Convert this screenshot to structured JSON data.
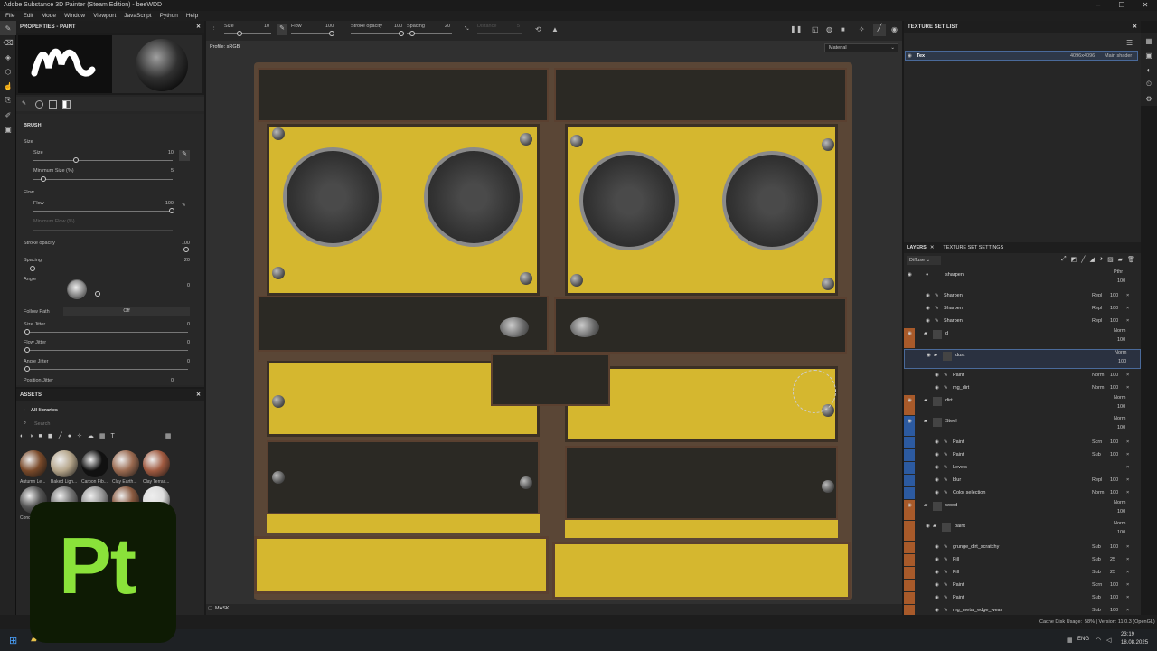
{
  "window": {
    "title": "Adobe Substance 3D Painter (Steam Edition) - beeWDD"
  },
  "menu": [
    "File",
    "Edit",
    "Mode",
    "Window",
    "Viewport",
    "JavaScript",
    "Python",
    "Help"
  ],
  "toolbar": {
    "size_label": "Size",
    "size_value": "10",
    "flow_label": "Flow",
    "flow_value": "100",
    "stroke_label": "Stroke opacity",
    "stroke_value": "100",
    "spacing_label": "Spacing",
    "spacing_value": "20",
    "distance_label": "Distance",
    "distance_value": "5"
  },
  "viewport": {
    "profile": "Profile: sRGB",
    "mode_select": "Material",
    "mask_label": "MASK"
  },
  "properties": {
    "title": "PROPERTIES - PAINT",
    "brush_header": "BRUSH",
    "size_section": "Size",
    "size_label": "Size",
    "size_value": "10",
    "minsize_label": "Minimum Size (%)",
    "minsize_value": "5",
    "flow_section": "Flow",
    "flow_label": "Flow",
    "flow_value": "100",
    "minflow_label": "Minimum Flow (%)",
    "stroke_label": "Stroke opacity",
    "stroke_value": "100",
    "spacing_label": "Spacing",
    "spacing_value": "20",
    "angle_label": "Angle",
    "angle_value": "0",
    "follow_label": "Follow Path",
    "follow_value": "Off",
    "sizej_label": "Size Jitter",
    "sizej_value": "0",
    "flowj_label": "Flow Jitter",
    "flowj_value": "0",
    "anglej_label": "Angle Jitter",
    "anglej_value": "0",
    "posj_label": "Position Jitter",
    "posj_value": "0"
  },
  "assets": {
    "title": "ASSETS",
    "library": "All libraries",
    "search_placeholder": "Search",
    "items": [
      {
        "name": "Autumn Le...",
        "color": "#7a4a2a"
      },
      {
        "name": "Baked Ligh...",
        "color": "#b5a58a"
      },
      {
        "name": "Carbon Fib...",
        "color": "#111111"
      },
      {
        "name": "Clay Earth...",
        "color": "#9a6a50"
      },
      {
        "name": "Clay Terrac...",
        "color": "#a05a40"
      },
      {
        "name": "Conc...",
        "color": "#555555"
      },
      {
        "name": "",
        "color": "#777777"
      },
      {
        "name": "",
        "color": "#999999"
      },
      {
        "name": "",
        "color": "#8a5a40"
      },
      {
        "name": "",
        "color": "#dddddd"
      }
    ]
  },
  "texture_set": {
    "title": "TEXTURE SET LIST",
    "row_name": "Tex",
    "row_size": "4096x4096",
    "row_shader": "Main shader"
  },
  "layers": {
    "tab1": "LAYERS",
    "tab2": "TEXTURE SET SETTINGS",
    "channel": "Diffuse",
    "rows": [
      {
        "name": "sharpen",
        "blend": "Pthr",
        "op": "100",
        "indent": 0,
        "type": "layer"
      },
      {
        "name": "Sharpen",
        "blend": "Repl",
        "op": "100",
        "indent": 1,
        "type": "fx"
      },
      {
        "name": "Sharpen",
        "blend": "Repl",
        "op": "100",
        "indent": 1,
        "type": "fx"
      },
      {
        "name": "Sharpen",
        "blend": "Repl",
        "op": "100",
        "indent": 1,
        "type": "fx"
      },
      {
        "name": "d",
        "blend": "Norm",
        "op": "100",
        "indent": 0,
        "type": "folder"
      },
      {
        "name": "dust",
        "blend": "Norm",
        "op": "100",
        "indent": 1,
        "type": "folder"
      },
      {
        "name": "Paint",
        "blend": "Norm",
        "op": "100",
        "indent": 2,
        "type": "fx"
      },
      {
        "name": "mg_dirt",
        "blend": "Norm",
        "op": "100",
        "indent": 2,
        "type": "fx"
      },
      {
        "name": "dirt",
        "blend": "Norm",
        "op": "100",
        "indent": 0,
        "type": "folder"
      },
      {
        "name": "Steel",
        "blend": "Norm",
        "op": "100",
        "indent": 0,
        "type": "folder"
      },
      {
        "name": "Paint",
        "blend": "Scrn",
        "op": "100",
        "indent": 2,
        "type": "fx"
      },
      {
        "name": "Paint",
        "blend": "Sub",
        "op": "100",
        "indent": 2,
        "type": "fx"
      },
      {
        "name": "Levels",
        "blend": "",
        "op": "",
        "indent": 2,
        "type": "fx"
      },
      {
        "name": "blur",
        "blend": "Repl",
        "op": "100",
        "indent": 2,
        "type": "fx"
      },
      {
        "name": "Color selection",
        "blend": "Norm",
        "op": "100",
        "indent": 2,
        "type": "fx"
      },
      {
        "name": "wood",
        "blend": "Norm",
        "op": "100",
        "indent": 0,
        "type": "folder"
      },
      {
        "name": "paint",
        "blend": "Norm",
        "op": "100",
        "indent": 1,
        "type": "folder"
      },
      {
        "name": "grunge_dirt_scratchy",
        "blend": "Sub",
        "op": "100",
        "indent": 2,
        "type": "fx"
      },
      {
        "name": "Fill",
        "blend": "Sub",
        "op": "25",
        "indent": 2,
        "type": "fx"
      },
      {
        "name": "Fill",
        "blend": "Sub",
        "op": "25",
        "indent": 2,
        "type": "fx"
      },
      {
        "name": "Paint",
        "blend": "Scrn",
        "op": "100",
        "indent": 2,
        "type": "fx"
      },
      {
        "name": "Paint",
        "blend": "Sub",
        "op": "100",
        "indent": 2,
        "type": "fx"
      },
      {
        "name": "mg_metal_edge_wear",
        "blend": "Sub",
        "op": "100",
        "indent": 2,
        "type": "fx"
      }
    ]
  },
  "status": {
    "cache": "Cache Disk Usage:",
    "cache_val": "58% | Version: 11.0.3 (OpenGL)"
  },
  "taskbar": {
    "lang": "ENG",
    "time": "23:19",
    "date": "18.08.2025"
  },
  "logo": {
    "text": "Pt"
  },
  "colors": {
    "accent_orange": "#c8621f",
    "accent_blue": "#2c5aa0",
    "logo_green": "#8ae23a",
    "yellow": "#d5b72f"
  }
}
